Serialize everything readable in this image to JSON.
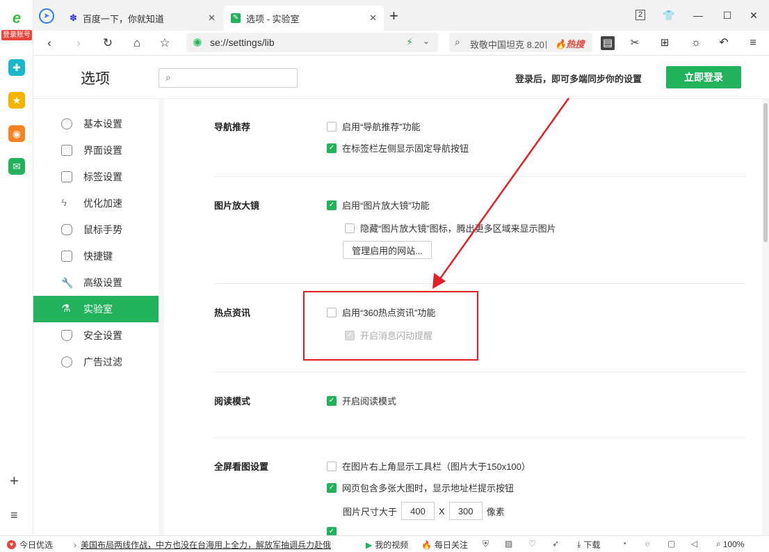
{
  "sidebar": {
    "login_badge": "登录账号",
    "items": [
      {
        "icon": "browser-logo-icon",
        "color": "#3cb84a"
      },
      {
        "icon": "app-plus-icon",
        "color": "#1bb6c9"
      },
      {
        "icon": "star-favorites-icon",
        "color": "#f5b400"
      },
      {
        "icon": "weibo-icon",
        "color": "#f58220"
      },
      {
        "icon": "mail-icon",
        "color": "#21b25b"
      }
    ],
    "add_icon": "+",
    "list_icon": "≡"
  },
  "tabs": [
    {
      "title": "百度一下，你就知道",
      "icon": "baidu-paw-icon"
    },
    {
      "title": "选项 - 实验室",
      "icon": "settings-wrench-icon",
      "active": true
    }
  ],
  "tabbar": {
    "new_tab": "+",
    "tab_count": "2"
  },
  "window_controls": {
    "minimize": "—",
    "maximize": "☐",
    "close": "✕"
  },
  "address": {
    "url": "se://settings/lib",
    "search_text": "致敬中国坦克 8.20日",
    "hot_label": "热搜"
  },
  "header": {
    "title": "选项",
    "search_placeholder": "",
    "sync_text": "登录后，即可多端同步你的设置",
    "login_button": "立即登录"
  },
  "menu": [
    {
      "label": "基本设置",
      "icon": "gear-icon"
    },
    {
      "label": "界面设置",
      "icon": "window-icon"
    },
    {
      "label": "标签设置",
      "icon": "tab-icon"
    },
    {
      "label": "优化加速",
      "icon": "lightning-icon"
    },
    {
      "label": "鼠标手势",
      "icon": "mouse-icon"
    },
    {
      "label": "快捷键",
      "icon": "keyboard-icon"
    },
    {
      "label": "高级设置",
      "icon": "wrench-icon"
    },
    {
      "label": "实验室",
      "icon": "flask-icon",
      "active": true
    },
    {
      "label": "安全设置",
      "icon": "shield-icon"
    },
    {
      "label": "广告过滤",
      "icon": "block-icon"
    }
  ],
  "sections": {
    "nav": {
      "title": "导航推荐",
      "opt1": "启用“导航推荐”功能",
      "opt1_checked": false,
      "opt2": "在标签栏左侧显示固定导航按钮",
      "opt2_checked": true
    },
    "zoom": {
      "title": "图片放大镜",
      "opt1": "启用“图片放大镜”功能",
      "opt1_checked": true,
      "opt2": "隐藏“图片放大镜”图标，腾出更多区域来显示图片",
      "opt2_checked": false,
      "button": "管理启用的网站..."
    },
    "hot": {
      "title": "热点资讯",
      "opt1": "启用“360热点资讯”功能",
      "opt1_checked": false,
      "opt2": "开启消息闪动提醒",
      "opt2_checked": true,
      "opt2_disabled": true
    },
    "read": {
      "title": "阅读模式",
      "opt1": "开启阅读模式",
      "opt1_checked": true
    },
    "fullscreen": {
      "title": "全屏看图设置",
      "opt1": "在图片右上角显示工具栏（图片大于150x100）",
      "opt1_checked": false,
      "opt2": "网页包含多张大图时，显示地址栏提示按钮",
      "opt2_checked": true,
      "size_label": "图片尺寸大于",
      "width": "400",
      "x": "X",
      "height": "300",
      "unit": "像素"
    }
  },
  "statusbar": {
    "today": "今日优选",
    "news": "美国布局两线作战，中方也没在台海用上全力，解放军抽调兵力赴俄",
    "video": "我的视频",
    "daily": "每日关注",
    "download": "下载",
    "zoom": "100%"
  }
}
